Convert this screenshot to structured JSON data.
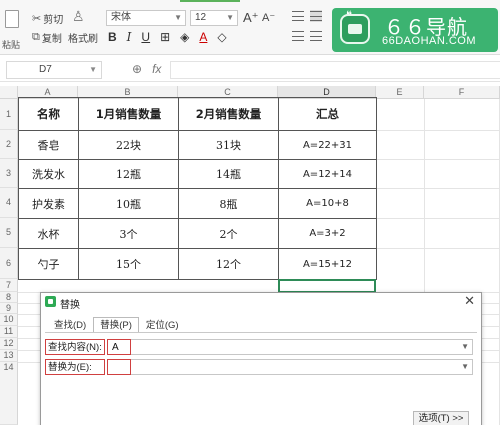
{
  "ribbon": {
    "paste_label": "粘贴",
    "cut_label": "剪切",
    "copy_label": "复制",
    "format_painter_label": "格式刷",
    "font_name": "宋体",
    "font_size": "12",
    "bold_label": "B",
    "italic_label": "I",
    "underline_label": "U",
    "grow_font_label": "A⁺",
    "shrink_font_label": "A⁻",
    "font_color_label": "A"
  },
  "logo": {
    "title": "６６导航",
    "subtitle": "66DAOHAN.COM"
  },
  "formula_bar": {
    "cell_ref": "D7",
    "fx_label": "fx",
    "content": ""
  },
  "sheet": {
    "columns": [
      "A",
      "B",
      "C",
      "D",
      "E",
      "F"
    ],
    "selected_column": "D",
    "rows": [
      "1",
      "2",
      "3",
      "4",
      "5",
      "6",
      "7",
      "8",
      "9",
      "10",
      "11",
      "12",
      "13",
      "14"
    ],
    "table": {
      "headers": [
        "名称",
        "1月销售数量",
        "2月销售数量",
        "汇总"
      ],
      "rows": [
        [
          "香皂",
          "22块",
          "31块",
          "A=22+31"
        ],
        [
          "洗发水",
          "12瓶",
          "14瓶",
          "A=12+14"
        ],
        [
          "护发素",
          "10瓶",
          "8瓶",
          "A=10+8"
        ],
        [
          "水杯",
          "3个",
          "2个",
          "A=3+2"
        ],
        [
          "勺子",
          "15个",
          "12个",
          "A=15+12"
        ]
      ]
    },
    "selected_cell": "D7"
  },
  "dialog": {
    "title": "替换",
    "tabs": [
      {
        "label": "查找(D)",
        "active": false
      },
      {
        "label": "替换(P)",
        "active": true
      },
      {
        "label": "定位(G)",
        "active": false
      }
    ],
    "find_label": "查找内容(N):",
    "find_value": "A",
    "replace_label": "替换为(E):",
    "replace_value": "",
    "options_button": "选项(T) >>"
  }
}
